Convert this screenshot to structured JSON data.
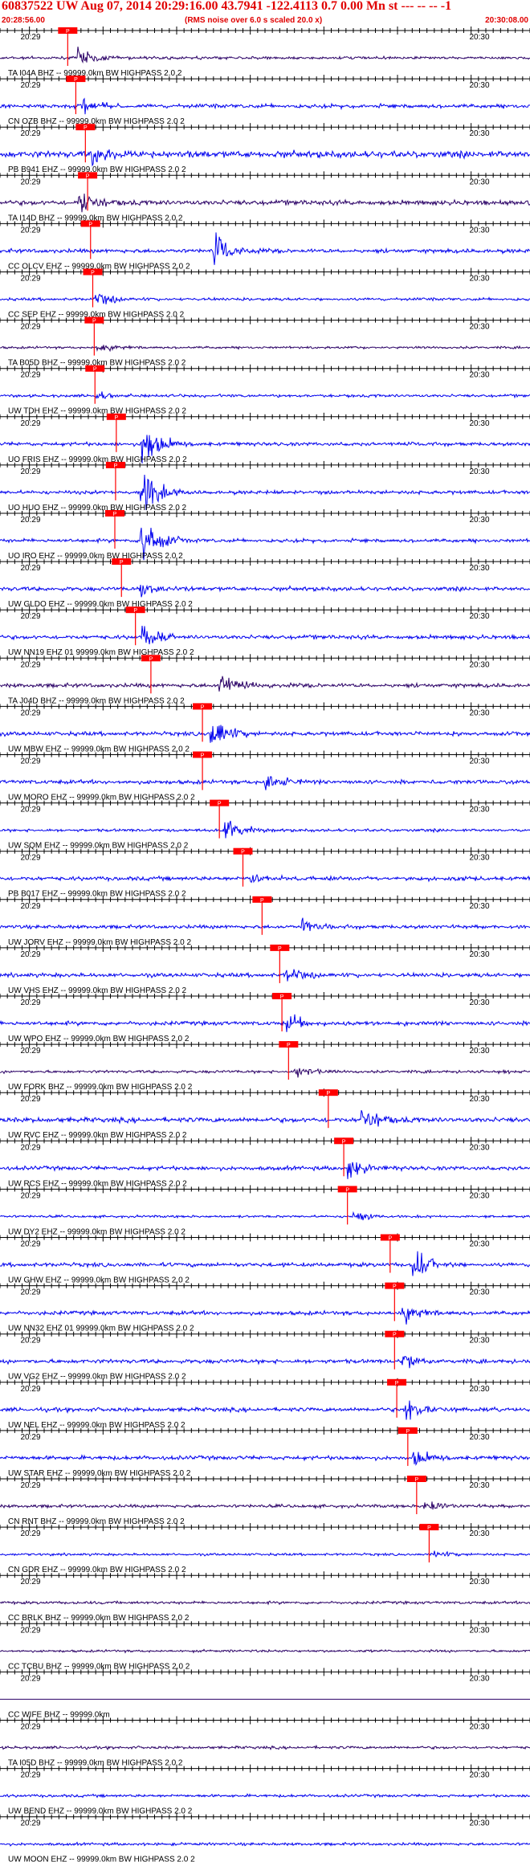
{
  "header": {
    "title": "60837522 UW Aug 07, 2014 20:29:16.00   43.7941 -122.4113  0.7 0.00 Mn st --- -- --  -1",
    "start_time": "20:28:56.00",
    "note": "(RMS noise over 6.0 s scaled 20.0 x)",
    "end_time": "20:30:08.00"
  },
  "colors": {
    "trace_a": "#0000ee",
    "trace_b": "#2a0066",
    "pick": "#ff0000",
    "axis": "#000000",
    "header_text": "#e00000"
  },
  "chart_data": {
    "type": "seismogram",
    "x_range": [
      "20:28:56",
      "20:30:08"
    ],
    "time_unit": "seconds after 20:28:56",
    "tick_labels": {
      "left": "20:29",
      "right": "20:30"
    },
    "pick_label": "P",
    "channels": [
      {
        "label": "TA I04A BHZ -- 99999.0km BW  HIGHPASS  2.0  2",
        "pick_s": 9.2,
        "burst_s": 10.5,
        "noise": 0.35,
        "amp": 0.9,
        "color": "b"
      },
      {
        "label": "CN OZB BHZ -- 99999.0km BW  HIGHPASS  2.0  2",
        "pick_s": 10.3,
        "burst_s": 11.0,
        "noise": 0.5,
        "amp": 0.8,
        "color": "a"
      },
      {
        "label": "PB B941 EHZ -- 99999.0km BW  HIGHPASS  2.0  2",
        "pick_s": 11.6,
        "burst_s": 12.5,
        "noise": 0.8,
        "amp": 0.9,
        "color": "a"
      },
      {
        "label": "TA I14D BHZ -- 99999.0km BW  HIGHPASS  2.0  2",
        "pick_s": 11.9,
        "burst_s": 10.5,
        "noise": 0.6,
        "amp": 1.3,
        "color": "b"
      },
      {
        "label": "CC OLCV EHZ -- 99999.0km BW  HIGHPASS  2.0  2",
        "pick_s": 12.3,
        "burst_s": 29.0,
        "noise": 0.5,
        "amp": 1.4,
        "color": "a"
      },
      {
        "label": "CC SEP EHZ -- 99999.0km BW  HIGHPASS  2.0  2",
        "pick_s": 12.6,
        "burst_s": 12.9,
        "noise": 0.35,
        "amp": 0.7,
        "color": "a"
      },
      {
        "label": "TA B05D BHZ -- 99999.0km BW  HIGHPASS  2.0  2",
        "pick_s": 12.8,
        "burst_s": 13.0,
        "noise": 0.3,
        "amp": 0.5,
        "color": "b"
      },
      {
        "label": "UW TDH EHZ -- 99999.0km BW  HIGHPASS  2.0  2",
        "pick_s": 12.9,
        "burst_s": 13.0,
        "noise": 0.35,
        "amp": 0.4,
        "color": "a"
      },
      {
        "label": "UO FRIS EHZ -- 99999.0km BW  HIGHPASS  2.0  2",
        "pick_s": 15.8,
        "burst_s": 19.0,
        "noise": 0.45,
        "amp": 2.2,
        "color": "a"
      },
      {
        "label": "UO HUO EHZ -- 99999.0km BW  HIGHPASS  2.0  2",
        "pick_s": 15.7,
        "burst_s": 19.0,
        "noise": 0.45,
        "amp": 2.2,
        "color": "a"
      },
      {
        "label": "UO IRO EHZ -- 99999.0km BW  HIGHPASS  2.0  2",
        "pick_s": 15.6,
        "burst_s": 19.0,
        "noise": 0.45,
        "amp": 2.2,
        "color": "a"
      },
      {
        "label": "UW GLDO EHZ -- 99999.0km BW  HIGHPASS  2.0  2",
        "pick_s": 16.5,
        "burst_s": 19.0,
        "noise": 0.5,
        "amp": 1.0,
        "color": "a"
      },
      {
        "label": "UW NN19 EHZ 01 99999.0km BW  HIGHPASS  2.0  2",
        "pick_s": 18.4,
        "burst_s": 19.3,
        "noise": 0.5,
        "amp": 1.0,
        "color": "a"
      },
      {
        "label": "TA J04D BHZ -- 99999.0km BW  HIGHPASS  2.0  2",
        "pick_s": 20.5,
        "burst_s": 29.6,
        "noise": 0.5,
        "amp": 1.2,
        "color": "b"
      },
      {
        "label": "UW MBW EHZ -- 99999.0km BW  HIGHPASS  2.0  2",
        "pick_s": 27.5,
        "burst_s": 28.5,
        "noise": 0.5,
        "amp": 1.5,
        "color": "a"
      },
      {
        "label": "UW MORO EHZ -- 99999.0km BW  HIGHPASS  2.0  2",
        "pick_s": 27.5,
        "burst_s": 36.0,
        "noise": 0.5,
        "amp": 1.0,
        "color": "a"
      },
      {
        "label": "UW SQM EHZ -- 99999.0km BW  HIGHPASS  2.0  2",
        "pick_s": 29.8,
        "burst_s": 30.5,
        "noise": 0.35,
        "amp": 1.2,
        "color": "a"
      },
      {
        "label": "PB B017 EHZ -- 99999.0km BW  HIGHPASS  2.0  2",
        "pick_s": 33.0,
        "burst_s": 34.0,
        "noise": 0.5,
        "amp": 0.6,
        "color": "a"
      },
      {
        "label": "UW JORV EHZ -- 99999.0km BW  HIGHPASS  2.0  2",
        "pick_s": 35.6,
        "burst_s": 41.0,
        "noise": 0.45,
        "amp": 0.7,
        "color": "a"
      },
      {
        "label": "UW VHS EHZ -- 99999.0km BW  HIGHPASS  2.0  2",
        "pick_s": 38.0,
        "burst_s": 38.8,
        "noise": 0.5,
        "amp": 0.8,
        "color": "a"
      },
      {
        "label": "UW WPO EHZ -- 99999.0km BW  HIGHPASS  2.0  2",
        "pick_s": 38.3,
        "burst_s": 38.9,
        "noise": 0.5,
        "amp": 0.8,
        "color": "a"
      },
      {
        "label": "UW FORK BHZ -- 99999.0km BW  HIGHPASS  2.0  2",
        "pick_s": 39.2,
        "burst_s": 40.0,
        "noise": 0.35,
        "amp": 0.6,
        "color": "b"
      },
      {
        "label": "UW RVC EHZ -- 99999.0km BW  HIGHPASS  2.0  2",
        "pick_s": 44.6,
        "burst_s": 49.0,
        "noise": 0.6,
        "amp": 1.2,
        "color": "a"
      },
      {
        "label": "UW RCS EHZ -- 99999.0km BW  HIGHPASS  2.0  2",
        "pick_s": 46.7,
        "burst_s": 47.2,
        "noise": 0.5,
        "amp": 0.9,
        "color": "a"
      },
      {
        "label": "UW DY2 EHZ -- 99999.0km BW  HIGHPASS  2.0  2",
        "pick_s": 47.2,
        "burst_s": 48.0,
        "noise": 0.3,
        "amp": 0.5,
        "color": "a"
      },
      {
        "label": "UW GHW EHZ -- 99999.0km BW  HIGHPASS  2.0  2",
        "pick_s": 53.0,
        "burst_s": 56.0,
        "noise": 0.5,
        "amp": 1.5,
        "color": "a"
      },
      {
        "label": "UW NN32 EHZ 01 99999.0km BW  HIGHPASS  2.0  2",
        "pick_s": 53.6,
        "burst_s": 54.5,
        "noise": 0.5,
        "amp": 0.9,
        "color": "a"
      },
      {
        "label": "UW VG2 EHZ -- 99999.0km BW  HIGHPASS  2.0  2",
        "pick_s": 53.6,
        "burst_s": 54.5,
        "noise": 0.5,
        "amp": 0.8,
        "color": "a"
      },
      {
        "label": "UW NEL EHZ -- 99999.0km BW  HIGHPASS  2.0  2",
        "pick_s": 53.9,
        "burst_s": 55.0,
        "noise": 0.5,
        "amp": 1.2,
        "color": "a"
      },
      {
        "label": "UW STAR EHZ -- 99999.0km BW  HIGHPASS  2.0  2",
        "pick_s": 55.4,
        "burst_s": 56.0,
        "noise": 0.5,
        "amp": 0.8,
        "color": "a"
      },
      {
        "label": "CN RNT BHZ -- 99999.0km BW  HIGHPASS  2.0  2",
        "pick_s": 56.6,
        "burst_s": 57.5,
        "noise": 0.4,
        "amp": 0.8,
        "color": "b"
      },
      {
        "label": "CN GDR EHZ -- 99999.0km BW  HIGHPASS  2.0  2",
        "pick_s": 58.3,
        "burst_s": 59.0,
        "noise": 0.3,
        "amp": 0.3,
        "color": "a"
      },
      {
        "label": "CC BRLK BHZ -- 99999.0km BW  HIGHPASS  2.0  2",
        "pick_s": null,
        "burst_s": null,
        "noise": 0.35,
        "amp": 0,
        "color": "b"
      },
      {
        "label": "CC TCBU BHZ -- 99999.0km BW  HIGHPASS  2.0  2",
        "pick_s": null,
        "burst_s": null,
        "noise": 0.3,
        "amp": 0,
        "color": "b"
      },
      {
        "label": "CC WIFE BHZ -- 99999.0km",
        "pick_s": null,
        "burst_s": null,
        "noise": 0.0,
        "amp": 0,
        "color": "b"
      },
      {
        "label": "TA I05D BHZ -- 99999.0km BW  HIGHPASS  2.0  2",
        "pick_s": null,
        "burst_s": null,
        "noise": 0.35,
        "amp": 0,
        "color": "b"
      },
      {
        "label": "UW BEND EHZ -- 99999.0km BW  HIGHPASS  2.0  2",
        "pick_s": null,
        "burst_s": null,
        "noise": 0.35,
        "amp": 0,
        "color": "a"
      },
      {
        "label": "UW MOON EHZ -- 99999.0km BW  HIGHPASS  2.0  2",
        "pick_s": null,
        "burst_s": null,
        "noise": 0.35,
        "amp": 0,
        "color": "a"
      }
    ]
  }
}
